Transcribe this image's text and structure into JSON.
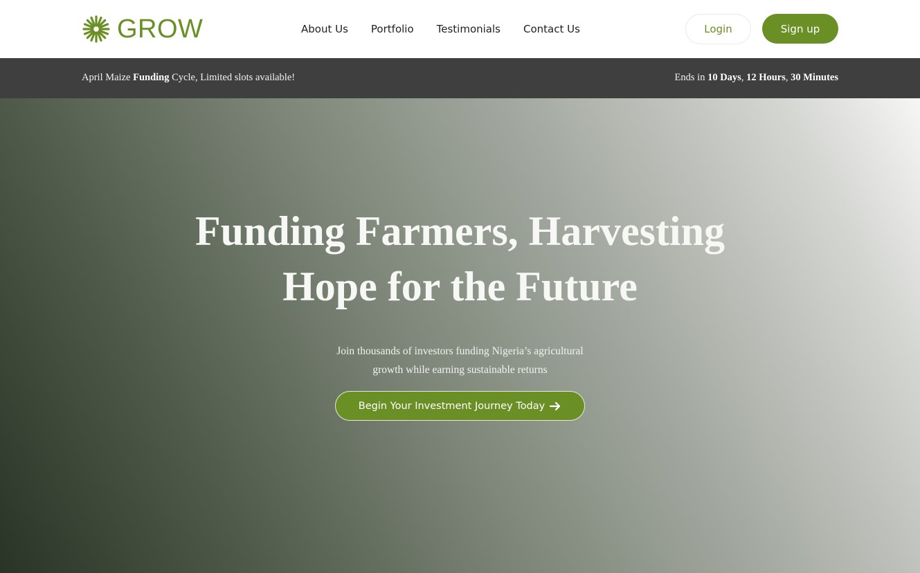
{
  "header": {
    "logo_text": "GROW",
    "logo_icon": "sunburst-icon",
    "nav": [
      "About Us",
      "Portfolio",
      "Testimonials",
      "Contact Us"
    ],
    "login_label": "Login",
    "signup_label": "Sign up"
  },
  "announcement": {
    "left_prefix": "April Maize ",
    "left_bold": "Funding",
    "left_suffix": " Cycle, Limited slots available!",
    "right_prefix": "Ends in ",
    "days": "10 Days",
    "sep1": ", ",
    "hours": "12 Hours",
    "sep2": ", ",
    "minutes": "30 Minutes"
  },
  "hero": {
    "title_line1": "Funding Farmers, Harvesting",
    "title_line2": "Hope for the Future",
    "subtitle_line1": "Join thousands of investors funding Nigeria’s agricultural",
    "subtitle_line2": "growth while earning sustainable returns",
    "cta_label": "Begin Your Investment Journey Today",
    "cta_icon": "arrow-right-icon"
  },
  "colors": {
    "brand_green": "#6a8f24",
    "announce_bg": "#3f3f3f"
  }
}
